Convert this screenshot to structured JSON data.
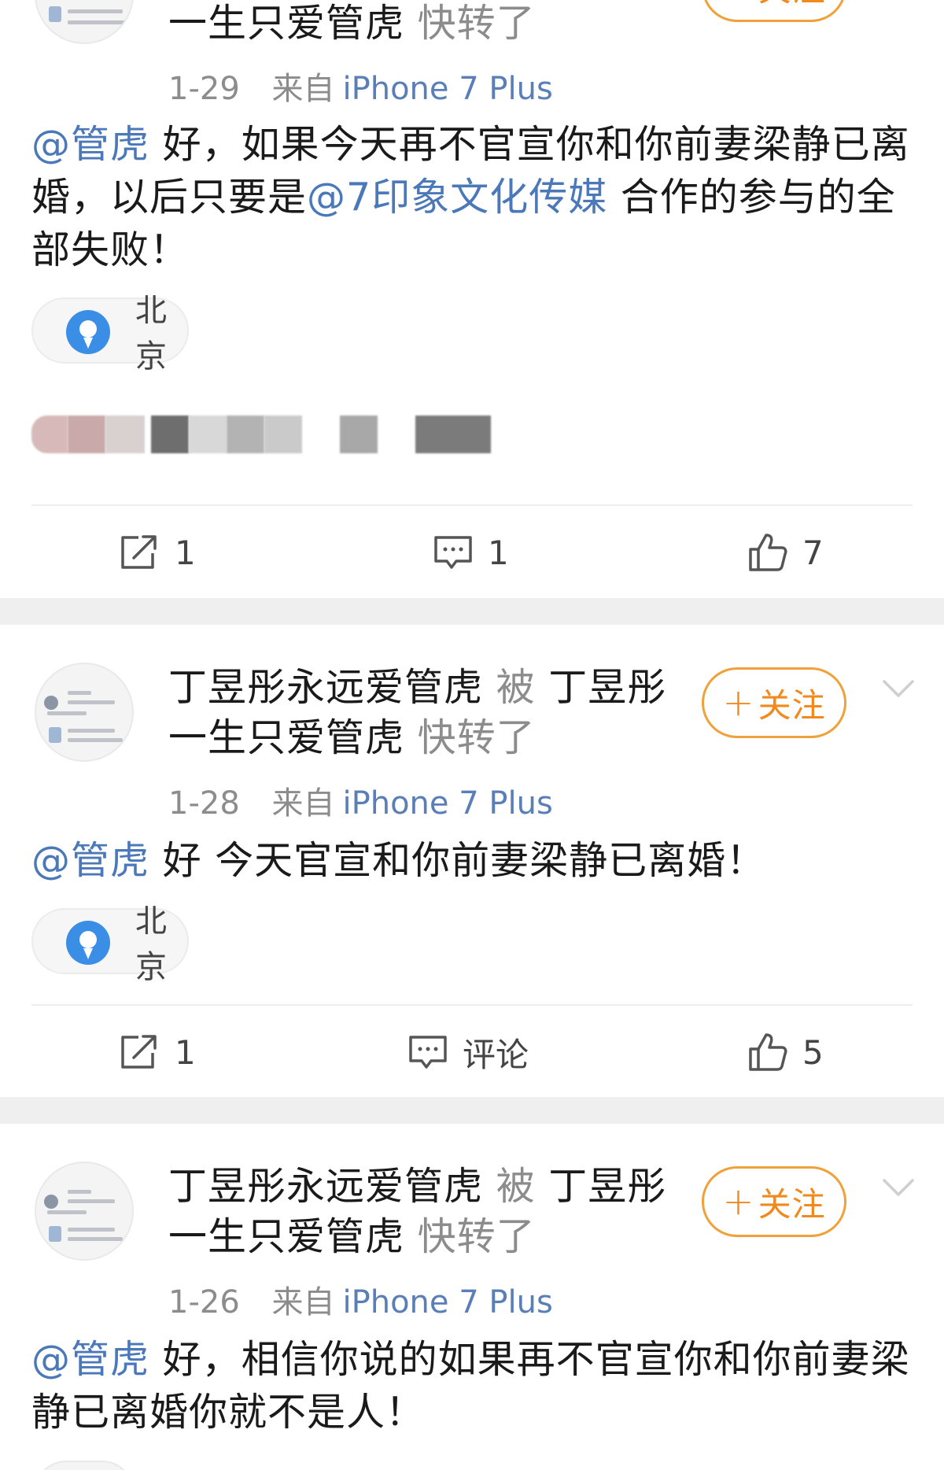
{
  "posts": [
    {
      "names_line1_a": "",
      "names_line1_b": "",
      "names_line1_c": "",
      "names_line2_a": "一生只爱管虎",
      "names_line2_b": "快转了",
      "follow_label": "关注",
      "date": "1-29",
      "source_prefix": "来自",
      "device": "iPhone 7 Plus",
      "mention1": "@管虎",
      "text1": " 好，如果今天再不官宣你和你前妻梁静已离婚，以后只要是",
      "mention2": "@7印象文化传媒",
      "text2": " 合作的参与的全部失败！",
      "location": "北京",
      "repost_count": "1",
      "comment_count": "1",
      "like_count": "7"
    },
    {
      "names_line1_a": "丁昱彤永远爱管虎",
      "names_line1_b": "被",
      "names_line1_c": "丁昱彤",
      "names_line2_a": "一生只爱管虎",
      "names_line2_b": "快转了",
      "follow_label": "关注",
      "date": "1-28",
      "source_prefix": "来自",
      "device": "iPhone 7 Plus",
      "mention1": "@管虎",
      "text1": " 好 今天官宣和你前妻梁静已离婚！",
      "location": "北京",
      "repost_count": "1",
      "comment_label": "评论",
      "like_count": "5"
    },
    {
      "names_line1_a": "丁昱彤永远爱管虎",
      "names_line1_b": "被",
      "names_line1_c": "丁昱彤",
      "names_line2_a": "一生只爱管虎",
      "names_line2_b": "快转了",
      "follow_label": "关注",
      "date": "1-26",
      "source_prefix": "来自",
      "device": "iPhone 7 Plus",
      "mention1": "@管虎",
      "text1": " 好，相信你说的如果再不官宣你和你前妻梁静已离婚你就不是人！"
    }
  ],
  "colors": {
    "mention": "#4b78b8",
    "follow_orange": "#f08a1c",
    "muted_gray": "#8c8c8c",
    "separator": "#efefef",
    "pin_blue": "#3a8ee6"
  },
  "icons": [
    "repost-icon",
    "comment-icon",
    "like-icon",
    "location-pin-icon",
    "chevron-down-icon",
    "plus-icon"
  ]
}
